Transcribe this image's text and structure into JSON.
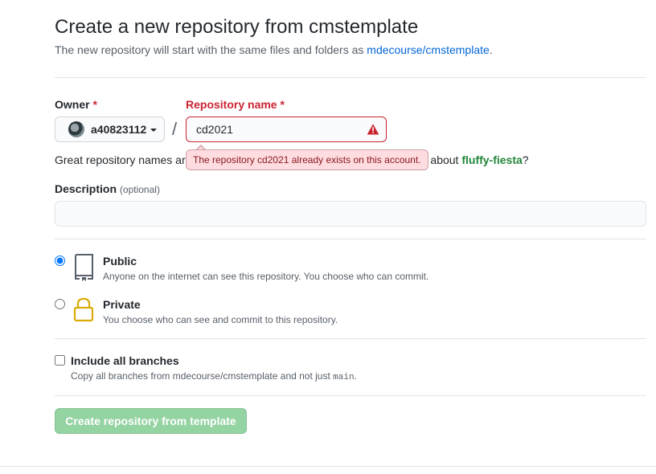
{
  "page": {
    "title": "Create a new repository from cmstemplate",
    "subtitle_prefix": "The new repository will start with the same files and folders as ",
    "subtitle_link": "mdecourse/cmstemplate",
    "subtitle_suffix": "."
  },
  "owner": {
    "label": "Owner",
    "required_mark": "*",
    "value": "a40823112",
    "avatar_icon": "user-avatar"
  },
  "separator": "/",
  "repo_name": {
    "label": "Repository name",
    "required_mark": "*",
    "value": "cd2021",
    "status_icon": "alert-triangle-icon",
    "error_color": "#cb2431",
    "error_tooltip": {
      "prefix": "The repository ",
      "name": "cd2021",
      "suffix": " already exists on this account."
    }
  },
  "hint": {
    "prefix": "Great repository names are",
    "middle": "about ",
    "suggestion": "fluffy-fiesta",
    "suffix": "?"
  },
  "description": {
    "label": "Description",
    "optional": "(optional)",
    "value": "",
    "placeholder": ""
  },
  "visibility": {
    "selected": "public",
    "public": {
      "title": "Public",
      "desc": "Anyone on the internet can see this repository. You choose who can commit.",
      "icon": "repo-book-icon"
    },
    "private": {
      "title": "Private",
      "desc": "You choose who can see and commit to this repository.",
      "icon": "lock-icon",
      "icon_color": "#dbab09"
    }
  },
  "branches": {
    "checked": false,
    "title": "Include all branches",
    "desc_prefix": "Copy all branches from mdecourse/cmstemplate and not just ",
    "desc_code": "main",
    "desc_suffix": "."
  },
  "submit": {
    "label": "Create repository from template",
    "color": "#94d3a2"
  }
}
